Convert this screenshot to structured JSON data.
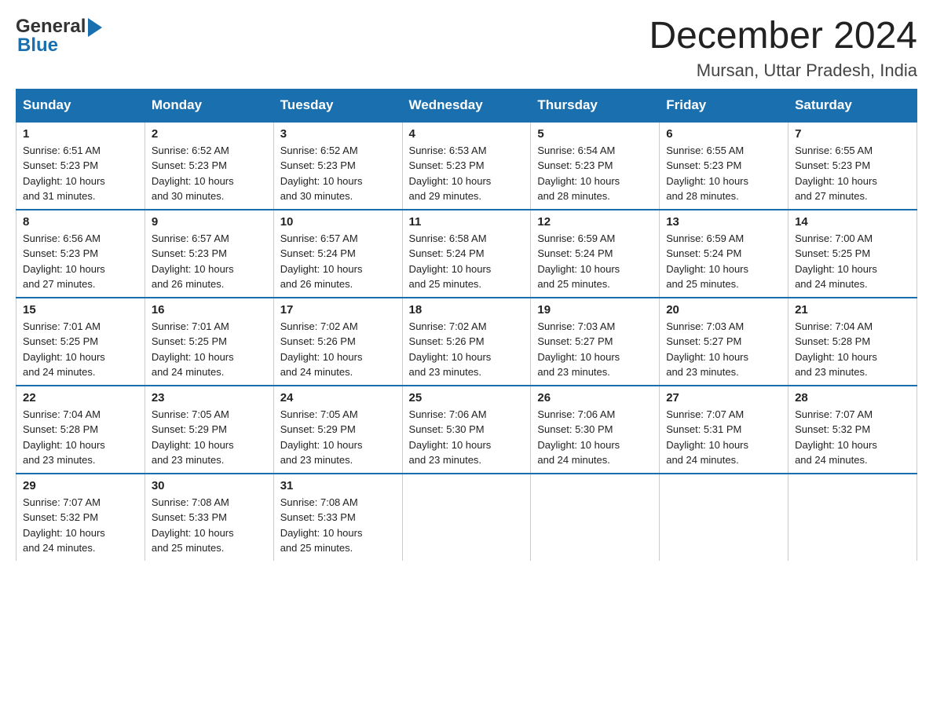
{
  "logo": {
    "general": "General",
    "blue": "Blue"
  },
  "title": {
    "month": "December 2024",
    "location": "Mursan, Uttar Pradesh, India"
  },
  "weekdays": [
    "Sunday",
    "Monday",
    "Tuesday",
    "Wednesday",
    "Thursday",
    "Friday",
    "Saturday"
  ],
  "weeks": [
    [
      {
        "day": "1",
        "sunrise": "6:51 AM",
        "sunset": "5:23 PM",
        "daylight": "10 hours and 31 minutes."
      },
      {
        "day": "2",
        "sunrise": "6:52 AM",
        "sunset": "5:23 PM",
        "daylight": "10 hours and 30 minutes."
      },
      {
        "day": "3",
        "sunrise": "6:52 AM",
        "sunset": "5:23 PM",
        "daylight": "10 hours and 30 minutes."
      },
      {
        "day": "4",
        "sunrise": "6:53 AM",
        "sunset": "5:23 PM",
        "daylight": "10 hours and 29 minutes."
      },
      {
        "day": "5",
        "sunrise": "6:54 AM",
        "sunset": "5:23 PM",
        "daylight": "10 hours and 28 minutes."
      },
      {
        "day": "6",
        "sunrise": "6:55 AM",
        "sunset": "5:23 PM",
        "daylight": "10 hours and 28 minutes."
      },
      {
        "day": "7",
        "sunrise": "6:55 AM",
        "sunset": "5:23 PM",
        "daylight": "10 hours and 27 minutes."
      }
    ],
    [
      {
        "day": "8",
        "sunrise": "6:56 AM",
        "sunset": "5:23 PM",
        "daylight": "10 hours and 27 minutes."
      },
      {
        "day": "9",
        "sunrise": "6:57 AM",
        "sunset": "5:23 PM",
        "daylight": "10 hours and 26 minutes."
      },
      {
        "day": "10",
        "sunrise": "6:57 AM",
        "sunset": "5:24 PM",
        "daylight": "10 hours and 26 minutes."
      },
      {
        "day": "11",
        "sunrise": "6:58 AM",
        "sunset": "5:24 PM",
        "daylight": "10 hours and 25 minutes."
      },
      {
        "day": "12",
        "sunrise": "6:59 AM",
        "sunset": "5:24 PM",
        "daylight": "10 hours and 25 minutes."
      },
      {
        "day": "13",
        "sunrise": "6:59 AM",
        "sunset": "5:24 PM",
        "daylight": "10 hours and 25 minutes."
      },
      {
        "day": "14",
        "sunrise": "7:00 AM",
        "sunset": "5:25 PM",
        "daylight": "10 hours and 24 minutes."
      }
    ],
    [
      {
        "day": "15",
        "sunrise": "7:01 AM",
        "sunset": "5:25 PM",
        "daylight": "10 hours and 24 minutes."
      },
      {
        "day": "16",
        "sunrise": "7:01 AM",
        "sunset": "5:25 PM",
        "daylight": "10 hours and 24 minutes."
      },
      {
        "day": "17",
        "sunrise": "7:02 AM",
        "sunset": "5:26 PM",
        "daylight": "10 hours and 24 minutes."
      },
      {
        "day": "18",
        "sunrise": "7:02 AM",
        "sunset": "5:26 PM",
        "daylight": "10 hours and 23 minutes."
      },
      {
        "day": "19",
        "sunrise": "7:03 AM",
        "sunset": "5:27 PM",
        "daylight": "10 hours and 23 minutes."
      },
      {
        "day": "20",
        "sunrise": "7:03 AM",
        "sunset": "5:27 PM",
        "daylight": "10 hours and 23 minutes."
      },
      {
        "day": "21",
        "sunrise": "7:04 AM",
        "sunset": "5:28 PM",
        "daylight": "10 hours and 23 minutes."
      }
    ],
    [
      {
        "day": "22",
        "sunrise": "7:04 AM",
        "sunset": "5:28 PM",
        "daylight": "10 hours and 23 minutes."
      },
      {
        "day": "23",
        "sunrise": "7:05 AM",
        "sunset": "5:29 PM",
        "daylight": "10 hours and 23 minutes."
      },
      {
        "day": "24",
        "sunrise": "7:05 AM",
        "sunset": "5:29 PM",
        "daylight": "10 hours and 23 minutes."
      },
      {
        "day": "25",
        "sunrise": "7:06 AM",
        "sunset": "5:30 PM",
        "daylight": "10 hours and 23 minutes."
      },
      {
        "day": "26",
        "sunrise": "7:06 AM",
        "sunset": "5:30 PM",
        "daylight": "10 hours and 24 minutes."
      },
      {
        "day": "27",
        "sunrise": "7:07 AM",
        "sunset": "5:31 PM",
        "daylight": "10 hours and 24 minutes."
      },
      {
        "day": "28",
        "sunrise": "7:07 AM",
        "sunset": "5:32 PM",
        "daylight": "10 hours and 24 minutes."
      }
    ],
    [
      {
        "day": "29",
        "sunrise": "7:07 AM",
        "sunset": "5:32 PM",
        "daylight": "10 hours and 24 minutes."
      },
      {
        "day": "30",
        "sunrise": "7:08 AM",
        "sunset": "5:33 PM",
        "daylight": "10 hours and 25 minutes."
      },
      {
        "day": "31",
        "sunrise": "7:08 AM",
        "sunset": "5:33 PM",
        "daylight": "10 hours and 25 minutes."
      },
      null,
      null,
      null,
      null
    ]
  ],
  "labels": {
    "sunrise": "Sunrise:",
    "sunset": "Sunset:",
    "daylight": "Daylight:"
  }
}
